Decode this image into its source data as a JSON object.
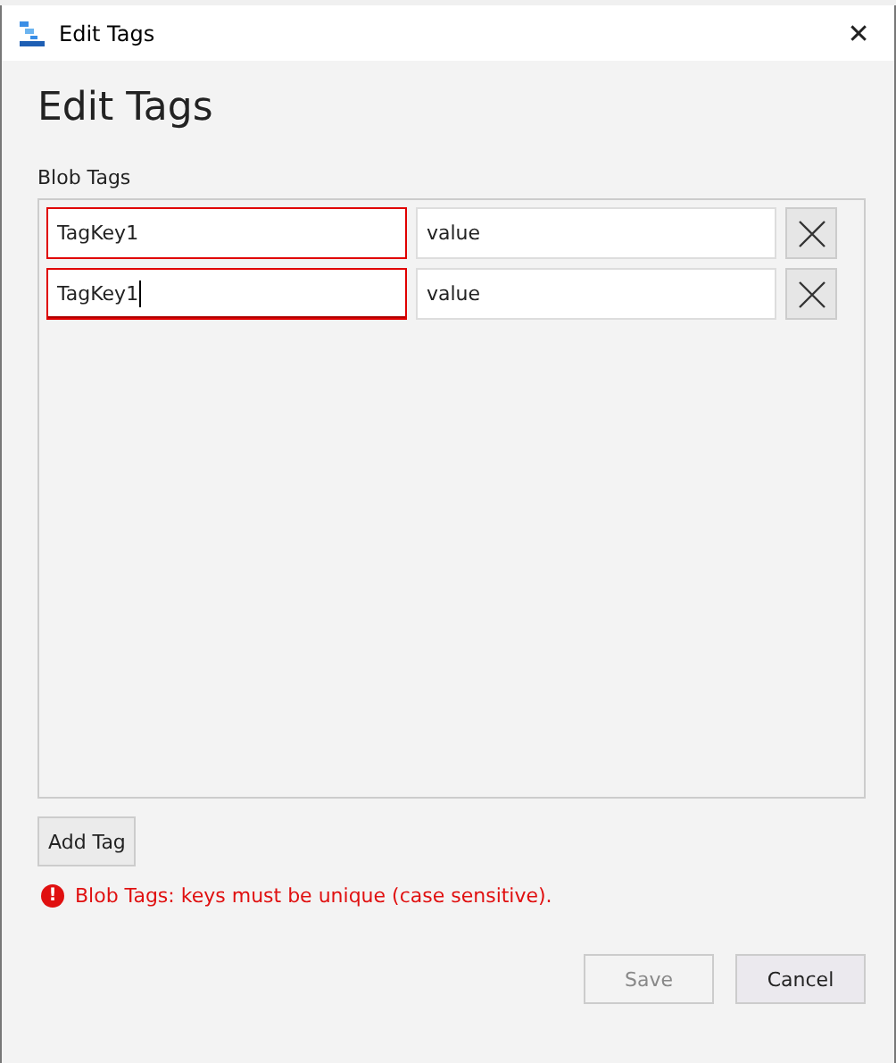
{
  "window": {
    "title": "Edit Tags",
    "close": "✕"
  },
  "heading": "Edit Tags",
  "tags_label": "Blob Tags",
  "tags": [
    {
      "key": "TagKey1",
      "value": "value",
      "invalid": true,
      "focused": false
    },
    {
      "key": "TagKey1",
      "value": "value",
      "invalid": true,
      "focused": true
    }
  ],
  "add_button": "Add Tag",
  "error": {
    "icon": "!",
    "text": "Blob Tags: keys must be unique (case sensitive)."
  },
  "buttons": [
    {
      "label": "Save",
      "disabled": true
    },
    {
      "label": "Cancel",
      "disabled": false
    }
  ]
}
